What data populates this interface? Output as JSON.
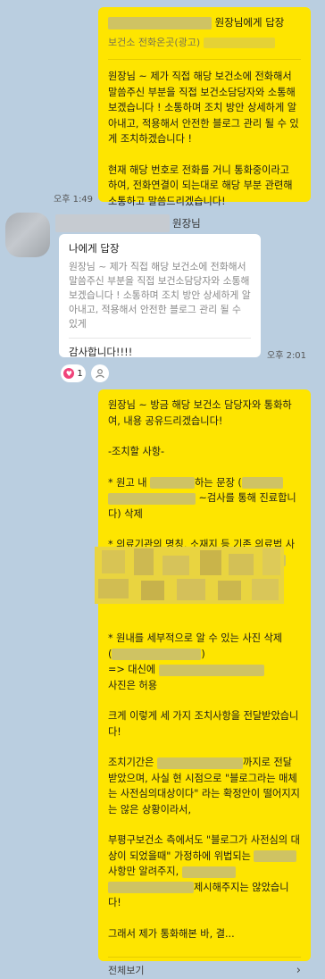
{
  "messages": {
    "first": {
      "reply_to": "원장님에게 답장",
      "quote": "보건소 전화온곳(광고)",
      "paragraphs": [
        "원장님 ~ 제가 직접 해당 보건소에 전화해서 말씀주신 부분을 직접 보건소담당자와 소통해보겠습니다 ! 소통하며 조치 방안 상세하게 알아내고, 적용해서 안전한 블로그 관리 될 수 있게 조치하겠습니다 !",
        "현재 해당 번호로 전화를 거니 통화중이라고 하여, 전화연결이 되는대로 해당 부분 관련해 소통하고 말씀드리겠습니다!"
      ],
      "time": "오후 1:49"
    },
    "second": {
      "sender": "원장님",
      "reply_to": "나에게 답장",
      "quote": "원장님 ~ 제가 직접 해당 보건소에 전화해서 말씀주신 부분을 직접 보건소담당자와 소통해보겠습니다 ! 소통하며 조치 방안 상세하게 알아내고, 적용해서 안전한 블로그 관리 될 수 있게",
      "text": "감사합니다!!!!",
      "time": "오후 2:01",
      "reaction_count": "1"
    },
    "third": {
      "p1": "원장님 ~ 방금 해당 보건소 담당자와 통화하여, 내용 공유드리겠습니다!",
      "p2": "-조치할 사항-",
      "p3a": "* 원고 내 ",
      "p3b": "하는 문장 (",
      "p3c": " ~검사를 통해 진료합니다) 삭제",
      "p4": "* 의료기관의 명칭, 소재지 등 기존 의료법 사항에 허용되었던 범위 내에서만 기재",
      "p5a": "* 원내를 세부적으로 알 수 있는 사진 삭제",
      "p5b": "(",
      "p5c": ")",
      "p5d": "=> 대신에 ",
      "p5e": " 사진은 허용",
      "p6": "크게 이렇게 세 가지 조치사항을 전달받았습니다!",
      "p7a": "조치기간은 ",
      "p7b": "까지로 전달받았으며, 사실 현 시점으로 \"블로그라는 매체는 사전심의대상이다\" 라는 확정안이 떨어지지는 않은 상황이라서,",
      "p8a": "부평구보건소 측에서도 \"블로그가 사전심의 대상이 되었을때\" 가정하에 위법되는 ",
      "p8b": "사항만 알려주지, ",
      "p8c": "제시해주지는 않았습니다!",
      "p9": "그래서 제가 통화해본 바, 결...",
      "more": "전체보기"
    }
  },
  "colors": {
    "background": "#bacee0",
    "my_bubble": "#fee500",
    "other_bubble": "#ffffff",
    "heart": "#f0437a"
  }
}
